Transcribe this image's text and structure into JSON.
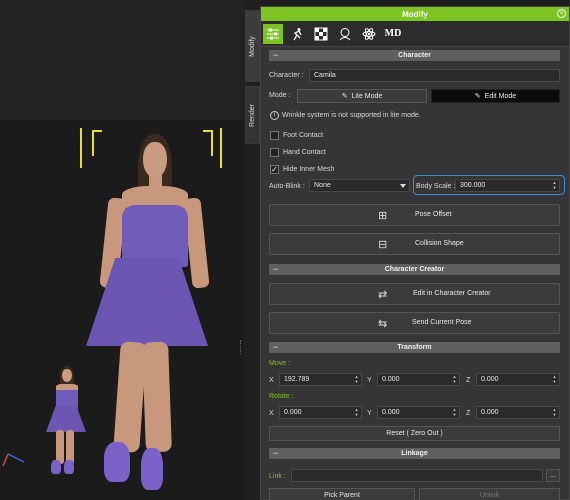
{
  "side_tabs": {
    "modify": "Modify",
    "render": "Render"
  },
  "panel": {
    "title": "Modify"
  },
  "toolbar": {
    "tools": [
      "sliders-icon",
      "run-icon",
      "checker-icon",
      "head-icon",
      "atom-icon",
      "md-logo"
    ],
    "md_label": "MD"
  },
  "character_section": {
    "header": "Character",
    "character_label": "Character :",
    "character_value": "Camila",
    "mode_label": "Mode :",
    "lite_mode": "Lite Mode",
    "edit_mode": "Edit Mode",
    "info_text": "Wrinkle system is not supported in lite mode.",
    "foot_contact": "Foot Contact",
    "hand_contact": "Hand Contact",
    "hide_inner_mesh": "Hide Inner Mesh",
    "foot_contact_checked": false,
    "hand_contact_checked": false,
    "hide_inner_mesh_checked": true,
    "auto_blink_label": "Auto-Blink :",
    "auto_blink_value": "None",
    "body_scale_label": "Body Scale :",
    "body_scale_value": "300.000",
    "pose_offset": "Pose Offset",
    "collision_shape": "Collision Shape"
  },
  "creator_section": {
    "header": "Character Creator",
    "edit_in_cc": "Edit in Character Creator",
    "send_pose": "Send Current Pose"
  },
  "transform_section": {
    "header": "Transform",
    "move_label": "Move :",
    "rotate_label": "Rotate :",
    "axis_x": "X",
    "axis_y": "Y",
    "axis_z": "Z",
    "move": {
      "x": "192.789",
      "y": "0.000",
      "z": "0.000"
    },
    "rotate": {
      "x": "0.000",
      "y": "0.000",
      "z": "0.000"
    },
    "reset": "Reset ( Zero Out )"
  },
  "linkage_section": {
    "header": "Linkage",
    "link_label": "Link :",
    "link_value": "",
    "browse": "...",
    "pick_parent": "Pick Parent",
    "unlink": "Unlink"
  },
  "colors": {
    "accent": "#7dc323",
    "focus": "#3b8fd8",
    "dress": "#6f5bb8"
  }
}
